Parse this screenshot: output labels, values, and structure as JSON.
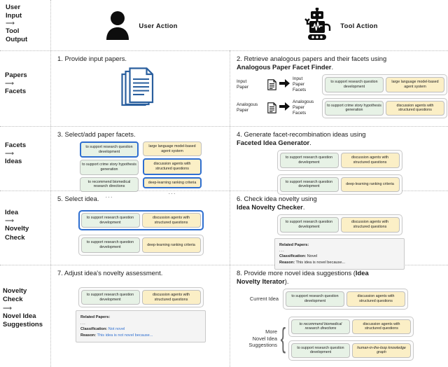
{
  "header": {
    "legend_label_lines": [
      "User",
      "Input",
      "Tool",
      "Output"
    ],
    "legend_arrow": "⟶",
    "user_actor": {
      "name": "User Action",
      "icon": "user-icon"
    },
    "tool_actor": {
      "name": "Tool Action",
      "icon": "robot-icon"
    }
  },
  "facets": {
    "f_support_research": "to support research question development",
    "f_llm_agent": "large language model-based agent system",
    "f_crime_story": "to support crime story hypothesis generation",
    "f_discussion_agents": "discussion agents with structured questions",
    "f_biomedical": "to recommend biomedical research directions",
    "f_deep_learning": "deep-learning ranking criteria",
    "f_hitl_kg": "human-in-the-loop knowledge graph",
    "ellipsis": "···"
  },
  "rows": [
    {
      "label_lines": [
        "Papers",
        "Facets"
      ],
      "arrow": "⟶",
      "left": {
        "step_number": "1.",
        "step_text": "Provide input papers.",
        "icon": "stacked-papers-icon"
      },
      "right": {
        "step_number": "2.",
        "step_text": "Retrieve analogous papers and their facets using",
        "tool_name": "Analogous Paper Facet Finder",
        "step_suffix": ".",
        "entries": [
          {
            "source_label": "Input\nPaper",
            "target_label": "Input\nPaper\nFacets",
            "chips": [
              "to support research question development",
              "large language model-based agent system"
            ]
          },
          {
            "source_label": "Analogous\nPaper",
            "target_label": "Analogous\nPaper\nFacets",
            "chips": [
              "to support crime story hypothesis generation",
              "discussion agents with structured questions"
            ]
          }
        ]
      }
    },
    {
      "label_lines": [
        "Facets",
        "Ideas"
      ],
      "arrow": "⟶",
      "left": {
        "step_number": "3.",
        "step_text": "Select/add paper facets.",
        "column_a": [
          {
            "text": "to support research question development",
            "selected": true
          },
          {
            "text": "to support crime story hypothesis generation",
            "selected": false
          },
          {
            "text": "to recommend biomedical research directions",
            "selected": false
          }
        ],
        "column_b": [
          {
            "text": "large language model-based agent system",
            "selected": false
          },
          {
            "text": "discussion agents with structured questions",
            "selected": true
          },
          {
            "text": "deep-learning ranking criteria",
            "selected": true
          }
        ]
      },
      "right": {
        "step_number": "4.",
        "step_text": "Generate facet-recombination ideas using",
        "tool_name": "Faceted Idea Generator",
        "step_suffix": ".",
        "ideas": [
          [
            "to support research question development",
            "discussion agents with structured questions"
          ],
          [
            "to support research question development",
            "deep-learning ranking criteria"
          ]
        ]
      }
    },
    {
      "label_lines": [
        "Idea",
        "Novelty",
        "Check"
      ],
      "arrow": "⟶",
      "left": {
        "step_number": "5.",
        "step_text": "Select idea.",
        "ideas": [
          {
            "chips": [
              "to support research question development",
              "discussion agents with structured questions"
            ],
            "selected": true
          },
          {
            "chips": [
              "to support research question development",
              "deep-learning ranking criteria"
            ],
            "selected": false
          }
        ]
      },
      "right": {
        "step_number": "6.",
        "step_text": "Check idea novelty using",
        "tool_name": "Idea Novelty Checker",
        "step_suffix": ".",
        "idea_chips": [
          "to support research question development",
          "discussion agents with structured questions"
        ],
        "report": {
          "related_papers_label": "Related Papers:",
          "related_papers_value": "...",
          "classification_label": "Classification:",
          "classification_value": "Novel",
          "reason_label": "Reason:",
          "reason_value": "This idea is novel because...",
          "edited": false
        }
      }
    },
    {
      "label_lines": [
        "Novelty",
        "Check",
        "Novel Idea",
        "Suggestions"
      ],
      "arrow": "⟶",
      "left": {
        "step_number": "7.",
        "step_text": "Adjust idea's novelty assessment.",
        "idea_chips": [
          "to support research question development",
          "discussion agents with structured questions"
        ],
        "report": {
          "related_papers_label": "Related Papers:",
          "related_papers_value": "...",
          "classification_label": "Classification:",
          "classification_value": "Not novel",
          "reason_label": "Reason:",
          "reason_value": "This idea is not novel because...",
          "edited": true
        }
      },
      "right": {
        "step_number": "8.",
        "step_text": "Provide more novel idea suggestions (",
        "tool_name": "Idea Novelty Iterator",
        "step_suffix": ").",
        "current_label": "Current Idea",
        "current_chips": [
          "to support research question development",
          "discussion agents with structured questions"
        ],
        "suggestions_label": "More\nNovel Idea\nSuggestions",
        "suggestions": [
          [
            {
              "text": "to recommend biomedical research directions",
              "new": true
            },
            {
              "text": "discussion agents with structured questions",
              "new": false
            }
          ],
          [
            {
              "text": "to support research question development",
              "new": false
            },
            {
              "text": "human-in-the-loop knowledge graph",
              "new": true
            }
          ]
        ]
      }
    }
  ],
  "colors": {
    "chip_green": "#e7f2e6",
    "chip_yellow": "#fbefc6",
    "selection_blue": "#2f6fd0",
    "paper_blue": "#2a5f9e",
    "panel_bg": "#f4f4f4"
  }
}
